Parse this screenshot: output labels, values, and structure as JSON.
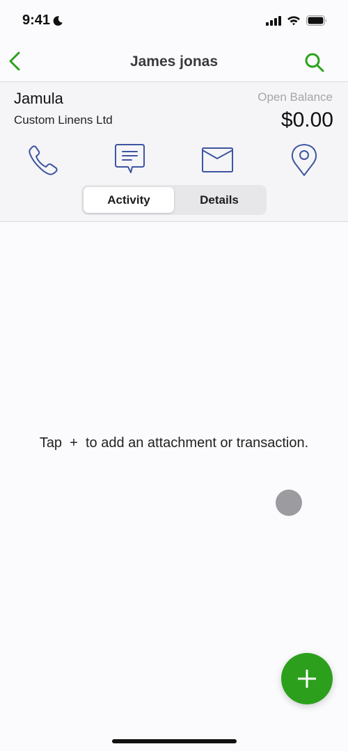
{
  "status_bar": {
    "time": "9:41",
    "icons": [
      "moon-icon",
      "cellular-signal-icon",
      "wifi-icon",
      "battery-icon"
    ]
  },
  "nav": {
    "title": "James jonas",
    "back_icon": "chevron-left-icon",
    "search_icon": "search-icon",
    "accent_color": "#2ca01c"
  },
  "customer": {
    "name": "Jamula",
    "company": "Custom Linens Ltd",
    "balance_label": "Open Balance",
    "balance_value": "$0.00"
  },
  "actions": [
    {
      "name": "call",
      "icon": "phone-icon"
    },
    {
      "name": "message",
      "icon": "message-icon"
    },
    {
      "name": "email",
      "icon": "mail-icon"
    },
    {
      "name": "map",
      "icon": "location-pin-icon"
    }
  ],
  "icon_color": "#3d55a0",
  "tabs": [
    {
      "label": "Activity",
      "active": true
    },
    {
      "label": "Details",
      "active": false
    }
  ],
  "empty_state": {
    "text": "Tap  +  to add an attachment or transaction."
  },
  "fab": {
    "icon": "plus-icon",
    "color": "#2ca01c"
  }
}
